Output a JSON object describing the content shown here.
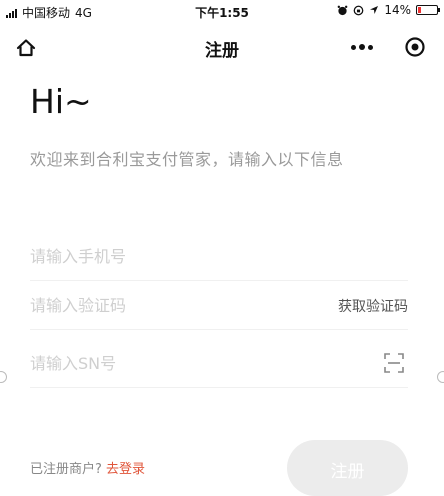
{
  "status_bar": {
    "carrier": "中国移动",
    "network": "4G",
    "time": "下午1:55",
    "battery": "14%",
    "battery_level": 0.14,
    "icons": [
      "alarm-icon",
      "orientation-lock-icon",
      "location-icon",
      "battery-icon"
    ]
  },
  "nav": {
    "title": "注册",
    "home_icon": "home-icon",
    "more_icon": "more-icon",
    "close_icon": "target-icon"
  },
  "greeting": {
    "title": "Hi~",
    "subtitle": "欢迎来到合利宝支付管家，请输入以下信息"
  },
  "form": {
    "phone_placeholder": "请输入手机号",
    "code_placeholder": "请输入验证码",
    "get_code_label": "获取验证码",
    "sn_placeholder": "请输入SN号",
    "scan_icon": "scan-icon"
  },
  "footer": {
    "login_question": "已注册商户?",
    "login_link": "去登录",
    "register_label": "注册"
  },
  "colors": {
    "accent": "#e0553a",
    "disabled_button": "#ececec",
    "placeholder": "#cfcfcf",
    "subtitle": "#9a9a9a"
  }
}
